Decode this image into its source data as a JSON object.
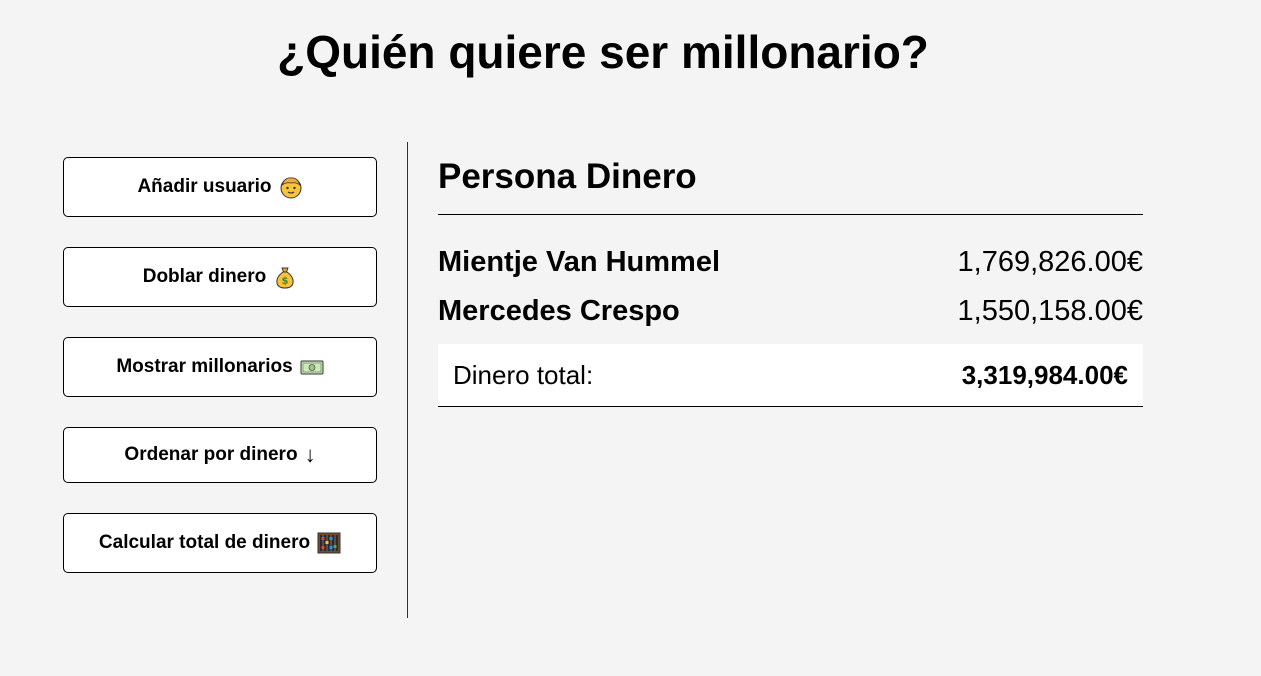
{
  "app": {
    "title": "¿Quién quiere ser millonario?"
  },
  "sidebar": {
    "buttons": [
      {
        "label": "Añadir usuario",
        "icon": "person-face-icon"
      },
      {
        "label": "Doblar dinero",
        "icon": "money-bag-icon"
      },
      {
        "label": "Mostrar millonarios",
        "icon": "banknote-icon"
      },
      {
        "label": "Ordenar por dinero",
        "icon": "down-arrow-icon",
        "glyph": "↓"
      },
      {
        "label": "Calcular total de dinero",
        "icon": "abacus-icon"
      }
    ]
  },
  "main": {
    "header": "Persona Dinero",
    "rows": [
      {
        "name": "Mientje Van Hummel",
        "money": "1,769,826.00€"
      },
      {
        "name": "Mercedes Crespo",
        "money": "1,550,158.00€"
      }
    ],
    "total": {
      "label": "Dinero total:",
      "value": "3,319,984.00€"
    }
  },
  "colors": {
    "background": "#f4f4f4",
    "button_background": "#ffffff",
    "border": "#000000",
    "emoji_yellow": "#f6c33a"
  }
}
